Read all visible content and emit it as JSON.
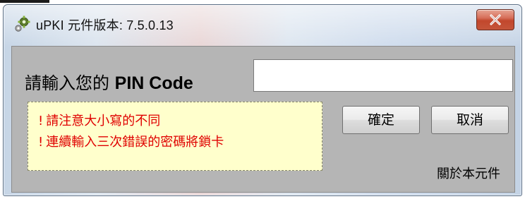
{
  "window": {
    "title": "uPKI 元件版本: 7.5.0.13",
    "app_icon": "gear-icon",
    "close_icon": "close-icon"
  },
  "form": {
    "pin_label_prefix": "請輸入您的",
    "pin_label_code": "PIN Code",
    "pin_value": "",
    "pin_placeholder": ""
  },
  "notice": {
    "bullet": "!",
    "line1": "請注意大小寫的不同",
    "line2": "連續輸入三次錯誤的密碼將鎖卡"
  },
  "buttons": {
    "ok_label": "確定",
    "cancel_label": "取消"
  },
  "about": {
    "label": "關於本元件"
  },
  "colors": {
    "notice_text": "#e00000",
    "notice_background": "#ffffcc",
    "client_background": "#b5b5b5",
    "close_button": "#c2472c"
  }
}
